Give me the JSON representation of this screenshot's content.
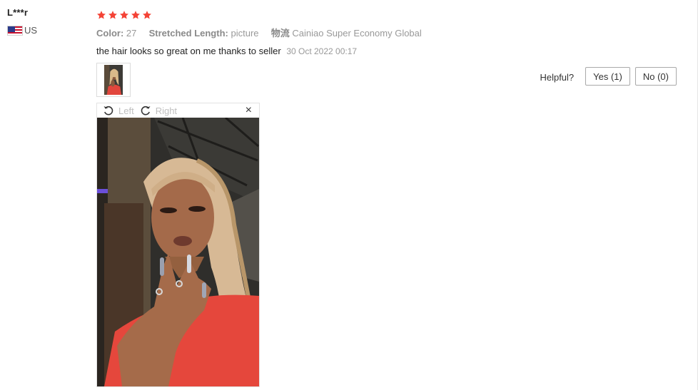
{
  "reviewer": {
    "name": "L***r",
    "country": "US",
    "flag_icon": "us-flag-icon"
  },
  "review": {
    "rating": 5,
    "star_color": "#f44336",
    "attributes": [
      {
        "key": "Color:",
        "value": "27"
      },
      {
        "key": "Stretched Length:",
        "value": "picture"
      },
      {
        "key": "物流",
        "value": "Cainiao Super Economy Global"
      }
    ],
    "text": "the hair looks so great on me thanks to seller",
    "date": "30 Oct 2022 00:17"
  },
  "helpful": {
    "label": "Helpful?",
    "yes_label": "Yes (1)",
    "no_label": "No (0)"
  },
  "viewer": {
    "rotate_left_label": "Left",
    "rotate_right_label": "Right",
    "close_icon": "×",
    "photo_icon": "review-photo"
  }
}
